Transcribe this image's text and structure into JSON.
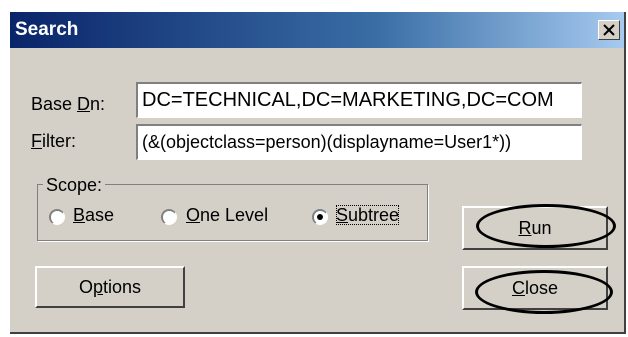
{
  "window": {
    "title": "Search",
    "close_glyph": "X"
  },
  "form": {
    "base_dn": {
      "label_prefix": "Base ",
      "label_key": "D",
      "label_rest": "n:",
      "value": "DC=TECHNICAL,DC=MARKETING,DC=COM"
    },
    "filter": {
      "label_key": "F",
      "label_rest": "ilter:",
      "value": "(&(objectclass=person)(displayname=User1*))"
    }
  },
  "scope": {
    "legend": "Scope:",
    "options": [
      {
        "key": "B",
        "rest": "ase",
        "selected": false
      },
      {
        "key": "O",
        "rest": "ne Level",
        "selected": false
      },
      {
        "key": "S",
        "rest": "ubtree",
        "selected": true
      }
    ]
  },
  "buttons": {
    "options": {
      "pre": "O",
      "key": "p",
      "rest": "tions"
    },
    "run": {
      "key": "R",
      "rest": "un"
    },
    "close": {
      "key": "C",
      "rest": "lose"
    }
  },
  "icons": {
    "close": "close-x-icon"
  }
}
